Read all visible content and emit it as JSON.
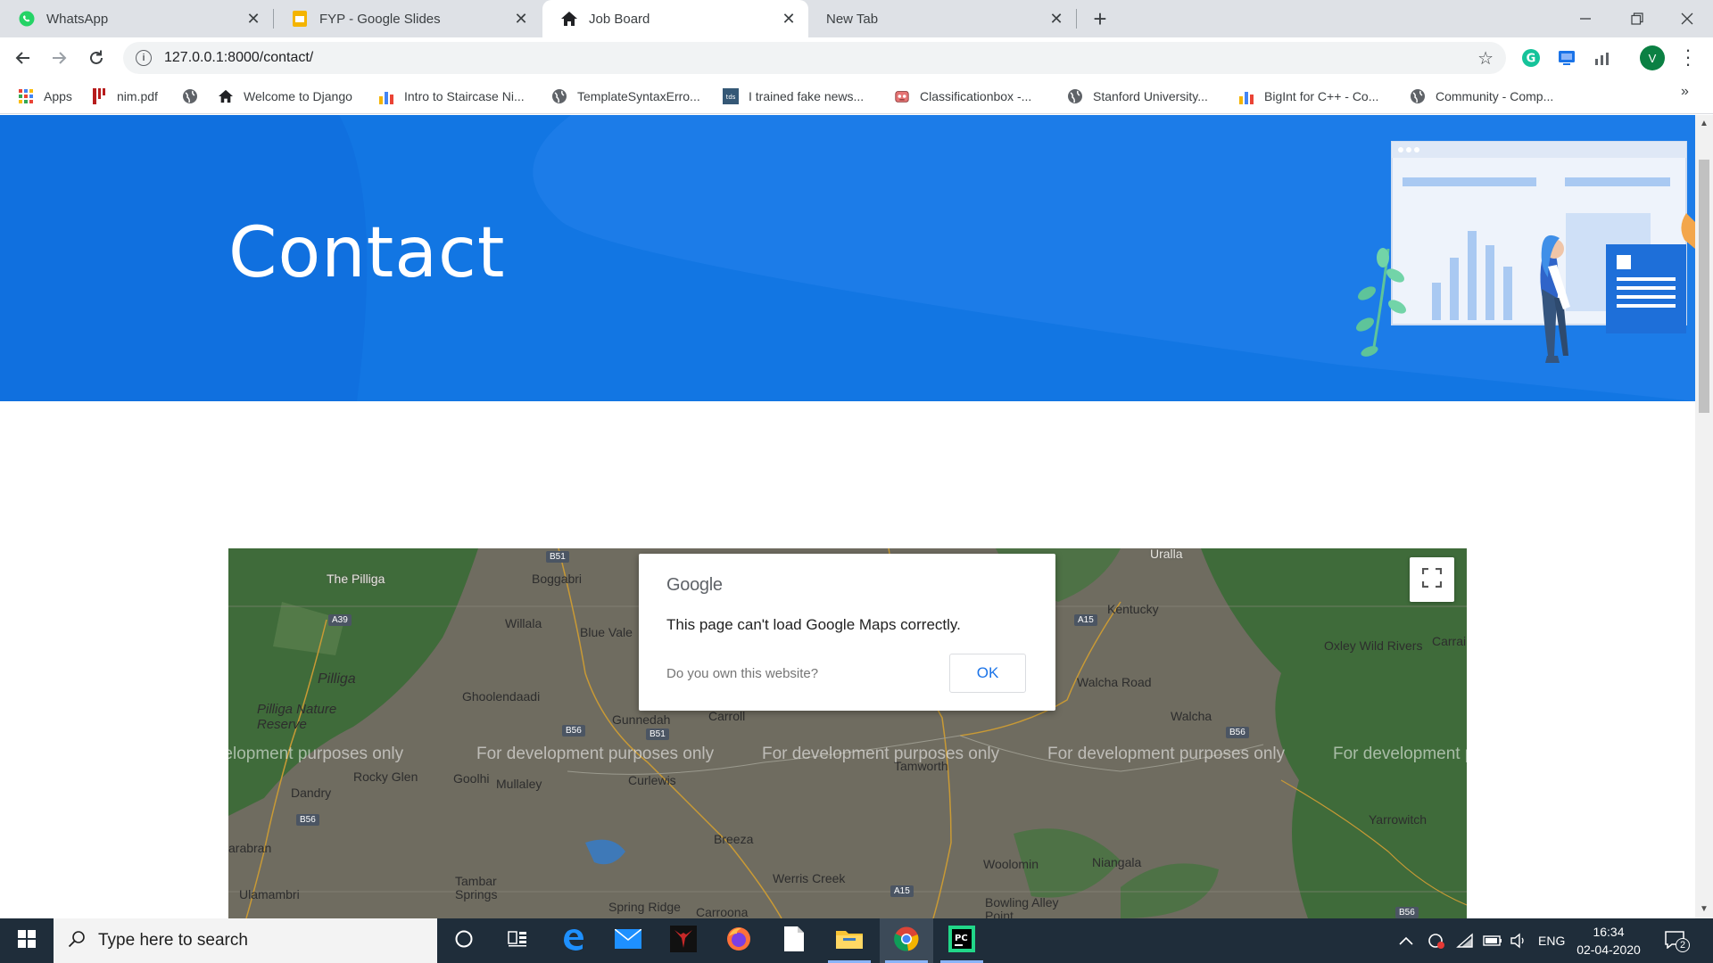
{
  "browser": {
    "tabs": [
      {
        "title": "WhatsApp",
        "icon": "whatsapp-icon"
      },
      {
        "title": "FYP - Google Slides",
        "icon": "google-slides-icon"
      },
      {
        "title": "Job Board",
        "icon": "home-icon",
        "active": true
      },
      {
        "title": "New Tab",
        "icon": ""
      }
    ],
    "url": "127.0.0.1:8000/contact/",
    "profile_initial": "V",
    "bookmarks": [
      {
        "label": "Apps",
        "icon": "apps-grid-icon"
      },
      {
        "label": "nim.pdf",
        "icon": "pdf-icon"
      },
      {
        "label": "",
        "icon": "globe-icon"
      },
      {
        "label": "Welcome to Django",
        "icon": "home-icon"
      },
      {
        "label": "Intro to Staircase Ni...",
        "icon": "bar-chart-icon"
      },
      {
        "label": "TemplateSyntaxErro...",
        "icon": "globe-icon"
      },
      {
        "label": "I trained fake news...",
        "icon": "tds-icon"
      },
      {
        "label": "Classificationbox -...",
        "icon": "robot-icon"
      },
      {
        "label": "Stanford University...",
        "icon": "globe-icon"
      },
      {
        "label": "BigInt for C++ - Co...",
        "icon": "bar-chart-icon"
      },
      {
        "label": "Community - Comp...",
        "icon": "globe-icon"
      }
    ]
  },
  "page": {
    "hero_title": "Contact",
    "map": {
      "watermark": "For development purposes only",
      "dialog": {
        "brand": "Google",
        "message": "This page can't load Google Maps correctly.",
        "question": "Do you own this website?",
        "ok_label": "OK"
      },
      "places": [
        "The Pilliga",
        "Boggabri",
        "Uralla",
        "Kentucky",
        "Willala",
        "Blue Vale",
        "Oxley Wild Rivers",
        "Carrai",
        "Pilliga",
        "Ghoolendaadi",
        "Walcha Road",
        "Pilliga Nature Reserve",
        "Gunnedah",
        "Carroll",
        "Walcha",
        "Rocky Glen",
        "Goolhi",
        "Mullaley",
        "Curlewis",
        "Tamworth",
        "Dandry",
        "Yarrowitch",
        "Breeza",
        "arabran",
        "Woolomin",
        "Niangala",
        "Werris Creek",
        "Tambar Springs",
        "Ulamambri",
        "Spring Ridge",
        "Carroona",
        "Bowling Alley Point"
      ],
      "road_badges": [
        "B51",
        "A39",
        "B56",
        "B51",
        "A15",
        "B56",
        "B56",
        "A15",
        "B56"
      ]
    }
  },
  "taskbar": {
    "search_placeholder": "Type here to search",
    "language": "ENG",
    "time": "16:34",
    "date": "02-04-2020",
    "notification_count": "2"
  },
  "colors": {
    "hero_blue": "#1276e3",
    "link_blue": "#1a73e8",
    "taskbar": "#1f2d3a"
  }
}
